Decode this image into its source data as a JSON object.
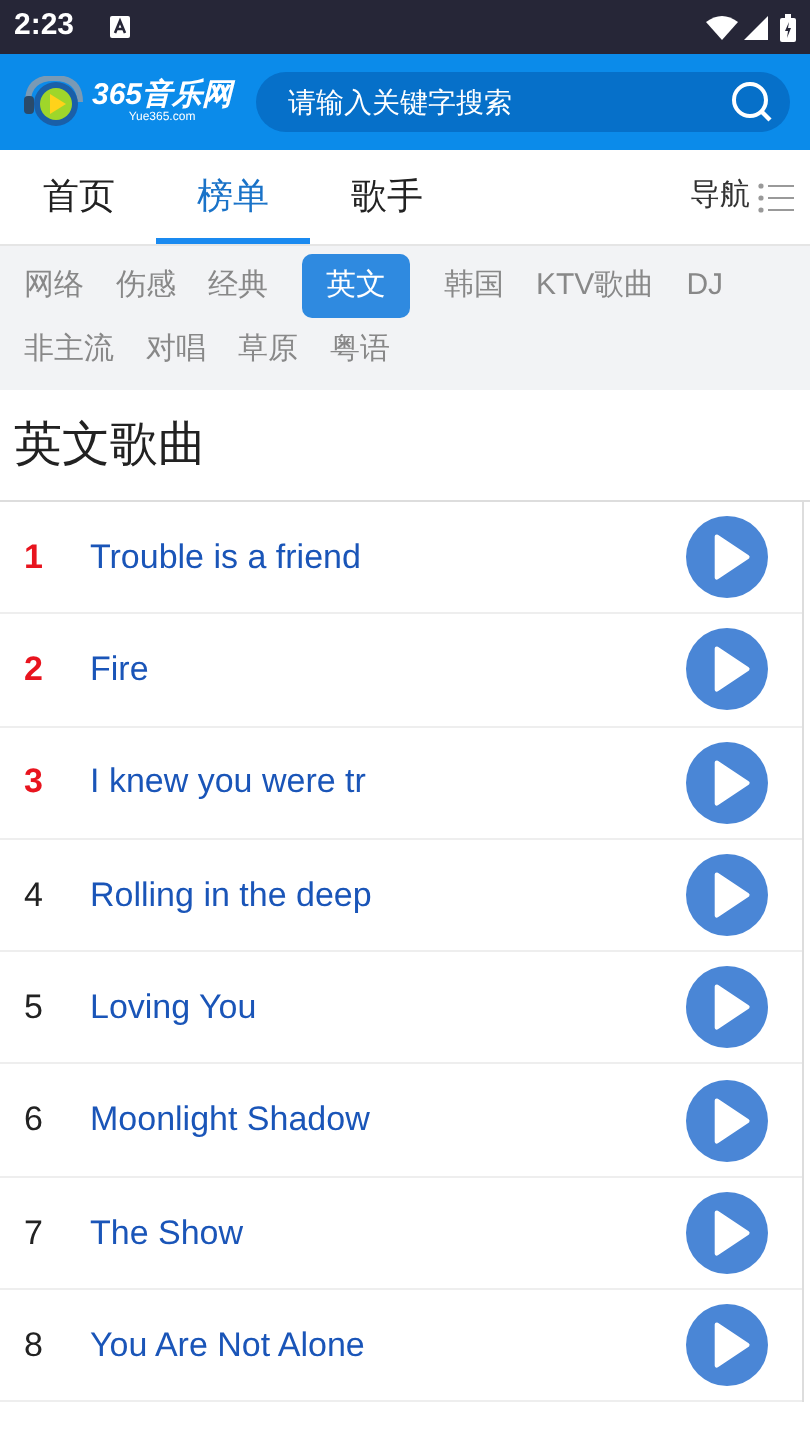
{
  "status_bar": {
    "time": "2:23"
  },
  "header": {
    "logo_text": "365音乐网",
    "logo_subtext": "Yue365.com",
    "search": {
      "placeholder": "请输入关键字搜索"
    }
  },
  "nav_tabs": [
    {
      "label": "首页",
      "selected": false
    },
    {
      "label": "榜单",
      "selected": true
    },
    {
      "label": "歌手",
      "selected": false
    }
  ],
  "nav_menu": {
    "label": "导航"
  },
  "categories": [
    {
      "label": "网络",
      "selected": false
    },
    {
      "label": "伤感",
      "selected": false
    },
    {
      "label": "经典",
      "selected": false
    },
    {
      "label": "英文",
      "selected": true
    },
    {
      "label": "韩国",
      "selected": false
    },
    {
      "label": "KTV歌曲",
      "selected": false
    },
    {
      "label": "DJ",
      "selected": false
    },
    {
      "label": "非主流",
      "selected": false
    },
    {
      "label": "对唱",
      "selected": false
    },
    {
      "label": "草原",
      "selected": false
    },
    {
      "label": "粤语",
      "selected": false
    }
  ],
  "section_title": "英文歌曲",
  "songs": [
    {
      "rank": "1",
      "title": "Trouble is a friend",
      "top": true
    },
    {
      "rank": "2",
      "title": "Fire",
      "top": true
    },
    {
      "rank": "3",
      "title": "I knew you were tr",
      "top": true
    },
    {
      "rank": "4",
      "title": "Rolling in the deep",
      "top": false
    },
    {
      "rank": "5",
      "title": "Loving You",
      "top": false
    },
    {
      "rank": "6",
      "title": "Moonlight Shadow",
      "top": false
    },
    {
      "rank": "7",
      "title": "The Show",
      "top": false
    },
    {
      "rank": "8",
      "title": "You Are Not Alone",
      "top": false
    }
  ]
}
